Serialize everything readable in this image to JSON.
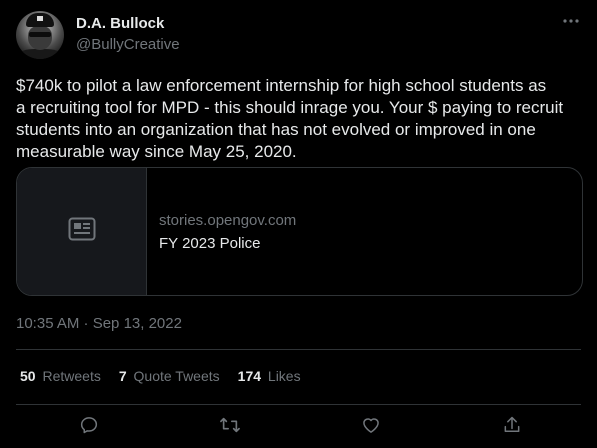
{
  "author": {
    "display_name": "D.A. Bullock",
    "handle": "@BullyCreative"
  },
  "more_icon": "more-horizontal-icon",
  "tweet": {
    "text_lines": [
      "$740k to pilot a law enforcement internship for high school students as",
      "a recruiting tool for MPD - this should inrage you. Your $ paying to recruit",
      "students into an organization that has not evolved or improved in one",
      "measurable way since May 25, 2020."
    ],
    "timestamp": "10:35 AM · Sep 13, 2022"
  },
  "link_card": {
    "icon": "article-icon",
    "domain": "stories.opengov.com",
    "title": "FY 2023 Police"
  },
  "stats": {
    "retweets_count": "50",
    "retweets_label": "Retweets",
    "quotes_count": "7",
    "quotes_label": "Quote Tweets",
    "likes_count": "174",
    "likes_label": "Likes"
  },
  "actions": [
    "reply-icon",
    "retweet-icon",
    "like-icon",
    "share-icon"
  ],
  "colors": {
    "background": "#000000",
    "text_primary": "#e7e9ea",
    "text_secondary": "#71767b",
    "border": "#2f3336",
    "card_thumb_bg": "#16181c"
  }
}
